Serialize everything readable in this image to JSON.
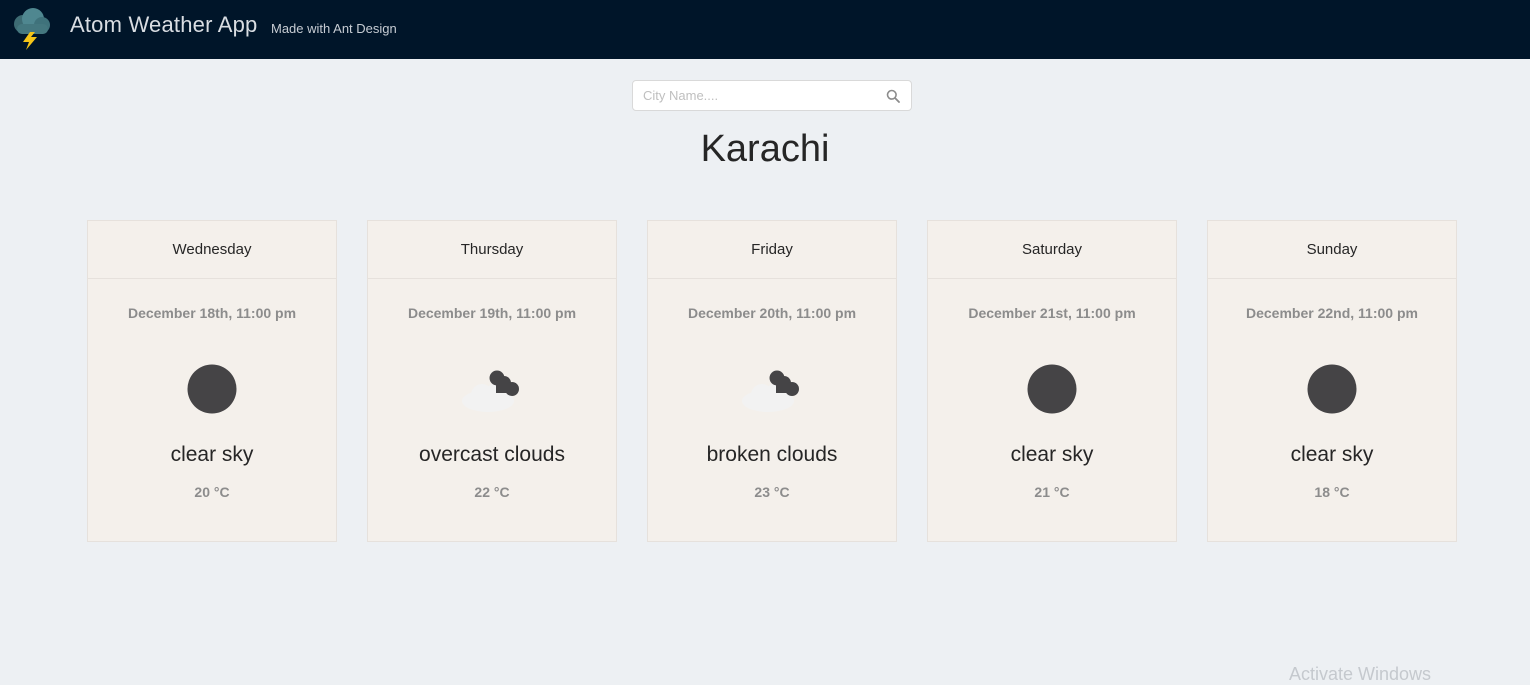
{
  "header": {
    "app_title": "Atom Weather App",
    "app_subtitle": "Made with Ant Design",
    "logo_icon": "cloud-lightning-icon",
    "background": "#001529"
  },
  "search": {
    "placeholder": "City Name....",
    "value": "",
    "icon": "search-icon"
  },
  "city": "Karachi",
  "forecast": [
    {
      "day": "Wednesday",
      "date": "December 18th, 11:00 pm",
      "icon": "moon-icon",
      "description": "clear sky",
      "temp": "20 °C"
    },
    {
      "day": "Thursday",
      "date": "December 19th, 11:00 pm",
      "icon": "night-cloudy-icon",
      "description": "overcast clouds",
      "temp": "22 °C"
    },
    {
      "day": "Friday",
      "date": "December 20th, 11:00 pm",
      "icon": "night-cloudy-icon",
      "description": "broken clouds",
      "temp": "23 °C"
    },
    {
      "day": "Saturday",
      "date": "December 21st, 11:00 pm",
      "icon": "moon-icon",
      "description": "clear sky",
      "temp": "21 °C"
    },
    {
      "day": "Sunday",
      "date": "December 22nd, 11:00 pm",
      "icon": "moon-icon",
      "description": "clear sky",
      "temp": "18 °C"
    }
  ],
  "watermark": "Activate Windows"
}
